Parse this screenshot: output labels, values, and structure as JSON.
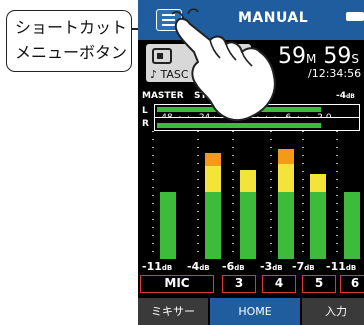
{
  "callout": {
    "line1": "ショートカット",
    "line2": "メニューボタン"
  },
  "header": {
    "title": "MANUAL",
    "menu_icon": "hamburger-menu-icon",
    "battery_icon": "battery-icon"
  },
  "recorder": {
    "file_name": "♪ TASC",
    "time_minutes": "59",
    "time_minutes_unit": "M",
    "time_seconds": "59",
    "time_seconds_unit": "S",
    "total_time": "/12:34:56"
  },
  "master": {
    "label": "MASTER",
    "mode": "STEREO",
    "level": "-4",
    "level_unit": "dB",
    "channel_left": "L",
    "channel_right": "R",
    "scale": "-48  ·  ·  -24 ·  ·  ·  -12 ·  ·  ·  -6  ·  ·  -2 0",
    "left_fill_fraction": 0.82,
    "right_fill_fraction": 0.82
  },
  "channels": [
    {
      "level": "-11",
      "unit": "dB",
      "green_fraction": 0.52,
      "yellow_fraction": 0.0,
      "orange_fraction": 0.0
    },
    {
      "level": "-4",
      "unit": "dB",
      "green_fraction": 0.52,
      "yellow_fraction": 0.2,
      "orange_fraction": 0.1
    },
    {
      "level": "-6",
      "unit": "dB",
      "green_fraction": 0.52,
      "yellow_fraction": 0.17,
      "orange_fraction": 0.0
    },
    {
      "level": "-3",
      "unit": "dB",
      "green_fraction": 0.52,
      "yellow_fraction": 0.22,
      "orange_fraction": 0.12
    },
    {
      "level": "-7",
      "unit": "dB",
      "green_fraction": 0.52,
      "yellow_fraction": 0.14,
      "orange_fraction": 0.0
    },
    {
      "level": "-11",
      "unit": "dB",
      "green_fraction": 0.52,
      "yellow_fraction": 0.0,
      "orange_fraction": 0.0
    }
  ],
  "inputs": [
    "MIC",
    "3",
    "4",
    "5",
    "6"
  ],
  "tabs": [
    "ミキサー",
    "HOME",
    "入力"
  ],
  "colors": {
    "header_blue": "#1f5d9e",
    "meter_green": "#3dbb3b",
    "meter_yellow": "#f2e43a",
    "meter_orange": "#f39a16",
    "input_border_red": "#e23535"
  }
}
